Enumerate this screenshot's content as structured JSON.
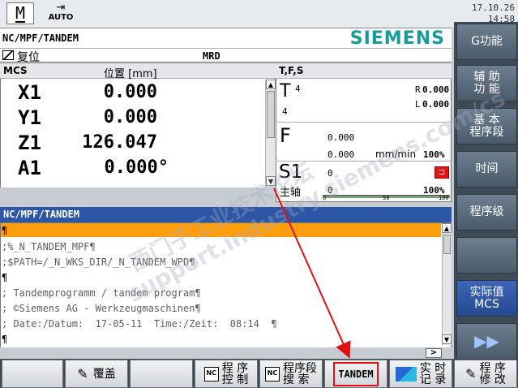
{
  "header": {
    "mode_icon": "M",
    "auto_label": "AUTO",
    "date": "17.10.26",
    "time": "14:58",
    "program_path": "NC/MPF/TANDEM",
    "brand": "SIEMENS",
    "status": "复位",
    "channel_state": "MRD"
  },
  "axes_panel": {
    "coord_system": "MCS",
    "position_header": "位置 [mm]",
    "axes": [
      {
        "name": "X1",
        "value": "0.000"
      },
      {
        "name": "Y1",
        "value": "0.000"
      },
      {
        "name": "Z1",
        "value": "126.047"
      },
      {
        "name": "A1",
        "value": "0.000°"
      }
    ]
  },
  "tfs_panel": {
    "title": "T,F,S",
    "tool": {
      "label": "T",
      "number": "4",
      "d_number": "4",
      "r_label": "R",
      "r_value": "0.000",
      "l_label": "L",
      "l_value": "0.000"
    },
    "feed": {
      "label": "F",
      "value1": "0.000",
      "value2": "0.000",
      "unit": "mm/min",
      "percent": "100%"
    },
    "spindle": {
      "label": "S1",
      "sub_label": "主轴",
      "value1": "0",
      "value2": "0",
      "percent": "100%",
      "scale": [
        "0",
        "50",
        "100"
      ]
    }
  },
  "program_panel": {
    "title": "NC/MPF/TANDEM",
    "lines": [
      "¶",
      ";%_N_TANDEM_MPF¶",
      ";$PATH=/_N_WKS_DIR/_N_TANDEM_WPD¶",
      "¶",
      "; Tandemprogramm / tandem program¶",
      "; ©Siemens AG - Werkzeugmaschinen¶",
      "; Date:/Datum:  17-05-11  Time:/Zeit:  08:14  ¶",
      "¶"
    ],
    "scroll_right": ">"
  },
  "softkeys": {
    "g_func": "G功能",
    "aux_func": "辅 助\n功 能",
    "basic_block": "基 本\n程序段",
    "time": "时间",
    "prog_level": "程序级",
    "blank": "",
    "actual_value": "实际值\nMCS",
    "next": "▶▶"
  },
  "hkeys": {
    "k1": "",
    "overlay": "覆盖",
    "k3": "",
    "prog_ctrl": "程 序\n控 制",
    "block_search": "程序段\n搜 索",
    "tandem": "TANDEM",
    "realtime_rec": "实 时\n记 录",
    "prog_modify": "程 序\n修 改"
  },
  "watermark": "西门子工业技术论坛\nsupport.industry.siemens.com/cs",
  "colors": {
    "header_bg": "#e7eaee",
    "softkey_bg": "#5a6b7b",
    "active_softkey": "#2f57a8",
    "program_title_bg": "#2c56a6",
    "highlight_line": "#ff9e0d",
    "arrow": "#e01010",
    "siemens": "#179a9a"
  }
}
